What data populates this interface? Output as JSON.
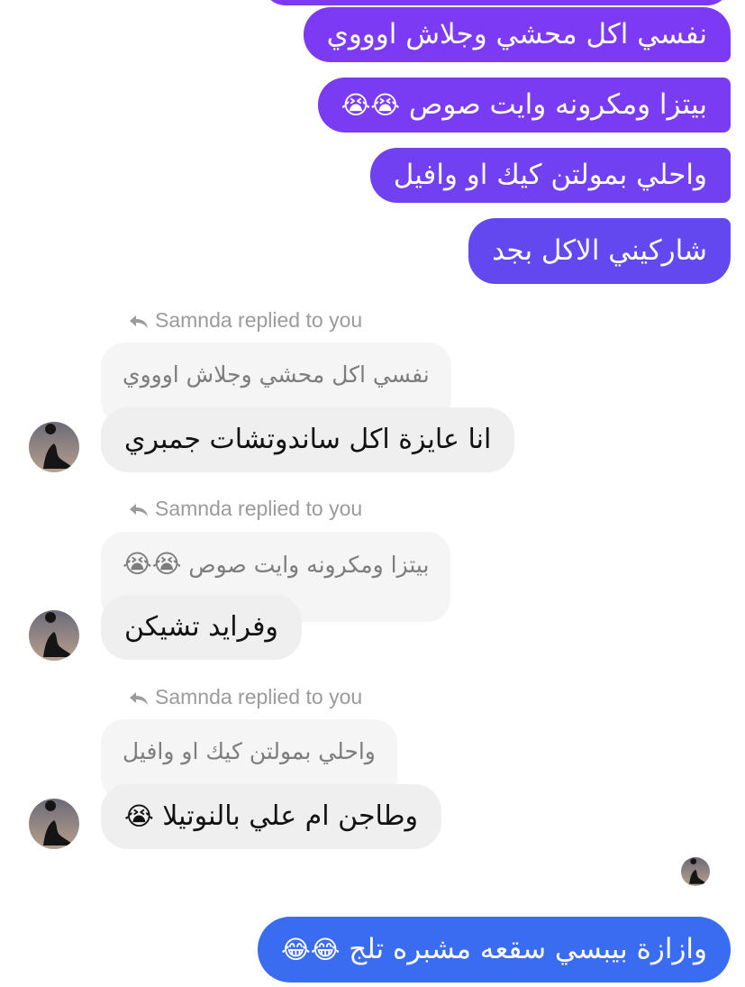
{
  "sent_messages": [
    {
      "text": "نفسي اكل محشي وجلاش اوووي",
      "emoji": ""
    },
    {
      "text": "بيتزا ومكرونه وايت صوص",
      "emoji": "😭😭"
    },
    {
      "text": "واحلي بمولتن كيك او وافيل",
      "emoji": ""
    },
    {
      "text": "شاركيني الاكل بجد",
      "emoji": ""
    }
  ],
  "replies": [
    {
      "label": "Samnda replied to you",
      "quoted": "نفسي اكل محشي وجلاش اوووي",
      "quoted_emoji": "",
      "message": "انا عايزة اكل ساندوتشات جمبري",
      "message_emoji": ""
    },
    {
      "label": "Samnda replied to you",
      "quoted": "بيتزا ومكرونه وايت صوص",
      "quoted_emoji": "😭😭",
      "message": "وفرايد تشيكن",
      "message_emoji": ""
    },
    {
      "label": "Samnda replied to you",
      "quoted": "واحلي بمولتن كيك او وافيل",
      "quoted_emoji": "",
      "message": "وطاجن ام علي بالنوتيلا",
      "message_emoji": "😭"
    }
  ],
  "last_sent": {
    "text": "وازازة بيبسي سقعه مشبره تلج",
    "emoji": "😂😂"
  },
  "colors": {
    "sent_top": "#7c3af5",
    "sent_bottom": "#3a6cf1",
    "received": "#efefef"
  }
}
